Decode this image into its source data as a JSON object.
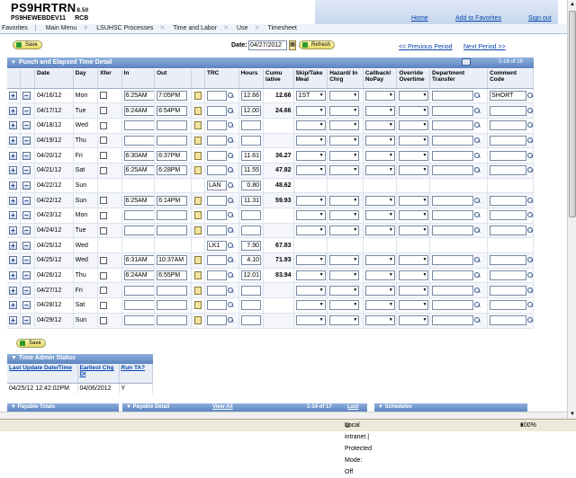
{
  "header": {
    "app_title": "PS9HRTRN",
    "version": "8.50",
    "db_name": "PS9HEWEBDEV11",
    "user": "RCB",
    "links": [
      "Home",
      "Add to Favorites",
      "Sign out"
    ]
  },
  "breadcrumb": [
    "Favorites",
    "Main Menu",
    "LSUHSC Processes",
    "Time and Labor",
    "Use",
    "Timesheet"
  ],
  "toolbar": {
    "save_label": "Save",
    "date_label": "Date:",
    "date_value": "04/27/2012",
    "refresh_label": "Refresh",
    "prev_period": "<< Previous Period",
    "next_period": "Next Period >>"
  },
  "grid": {
    "title": "Punch and Elapsed Time Detail",
    "count": "1-16 of 16",
    "columns": [
      "Date",
      "Day",
      "Xfer",
      "In",
      "Out",
      "TRC",
      "Hours",
      "Cumu lative",
      "Skip/Take Meal",
      "Hazard/ In Chrg",
      "Callback/ NoPay",
      "Override Overtime",
      "Department Transfer",
      "Comment Code"
    ],
    "rows": [
      {
        "date": "04/16/12",
        "day": "Mon",
        "in": "6:25AM",
        "out": "7:05PM",
        "trc": "",
        "hours": "12.66",
        "cum": "12.66",
        "meal": "1ST",
        "comment": "SHORT"
      },
      {
        "date": "04/17/12",
        "day": "Tue",
        "in": "6:24AM",
        "out": "6:54PM",
        "trc": "",
        "hours": "12.00",
        "cum": "24.66",
        "meal": "",
        "comment": ""
      },
      {
        "date": "04/18/12",
        "day": "Wed",
        "in": "",
        "out": "",
        "trc": "",
        "hours": "",
        "cum": "",
        "meal": "",
        "comment": ""
      },
      {
        "date": "04/19/12",
        "day": "Thu",
        "in": "",
        "out": "",
        "trc": "",
        "hours": "",
        "cum": "",
        "meal": "",
        "comment": ""
      },
      {
        "date": "04/20/12",
        "day": "Fri",
        "in": "6:30AM",
        "out": "6:37PM",
        "trc": "",
        "hours": "11.61",
        "cum": "36.27",
        "meal": "",
        "comment": ""
      },
      {
        "date": "04/21/12",
        "day": "Sat",
        "in": "6:25AM",
        "out": "6:28PM",
        "trc": "",
        "hours": "11.55",
        "cum": "47.82",
        "meal": "",
        "comment": ""
      },
      {
        "date": "04/22/12",
        "day": "Sun",
        "in": null,
        "out": null,
        "trc": "LAN",
        "hours": "0.80",
        "cum": "48.62",
        "meal": null,
        "comment": null
      },
      {
        "date": "04/22/12",
        "day": "Sun",
        "in": "6:25AM",
        "out": "6:14PM",
        "trc": "",
        "hours": "11.31",
        "cum": "59.93",
        "meal": "",
        "comment": ""
      },
      {
        "date": "04/23/12",
        "day": "Mon",
        "in": "",
        "out": "",
        "trc": "",
        "hours": "",
        "cum": "",
        "meal": "",
        "comment": ""
      },
      {
        "date": "04/24/12",
        "day": "Tue",
        "in": "",
        "out": "",
        "trc": "",
        "hours": "",
        "cum": "",
        "meal": "",
        "comment": ""
      },
      {
        "date": "04/25/12",
        "day": "Wed",
        "in": null,
        "out": null,
        "trc": "LK1",
        "hours": "7.90",
        "cum": "67.83",
        "meal": null,
        "comment": null
      },
      {
        "date": "04/25/12",
        "day": "Wed",
        "in": "6:31AM",
        "out": "10:37AM",
        "trc": "",
        "hours": "4.10",
        "cum": "71.93",
        "meal": "",
        "comment": ""
      },
      {
        "date": "04/26/12",
        "day": "Thu",
        "in": "6:24AM",
        "out": "6:55PM",
        "trc": "",
        "hours": "12.01",
        "cum": "83.94",
        "meal": "",
        "comment": ""
      },
      {
        "date": "04/27/12",
        "day": "Fri",
        "in": "",
        "out": "",
        "trc": "",
        "hours": "",
        "cum": "",
        "meal": "",
        "comment": ""
      },
      {
        "date": "04/28/12",
        "day": "Sat",
        "in": "",
        "out": "",
        "trc": "",
        "hours": "",
        "cum": "",
        "meal": "",
        "comment": ""
      },
      {
        "date": "04/29/12",
        "day": "Sun",
        "in": "",
        "out": "",
        "trc": "",
        "hours": "",
        "cum": "",
        "meal": "",
        "comment": ""
      }
    ]
  },
  "time_admin": {
    "title": "Time Admin Status",
    "headers": [
      "Last Update Date/Time",
      "Earliest Chg Dt",
      "Run TA?"
    ],
    "values": [
      "04/25/12 12:42:02PM",
      "04/06/2012",
      "Y"
    ]
  },
  "bottom_sections": [
    "Payable Totals",
    "Payable Detail",
    "Schedules"
  ],
  "bottom_links": [
    "View All",
    "1-14 of 17",
    "Last"
  ],
  "statusbar": {
    "zone": "Local intranet | Protected Mode: Off",
    "zoom": "100%"
  }
}
